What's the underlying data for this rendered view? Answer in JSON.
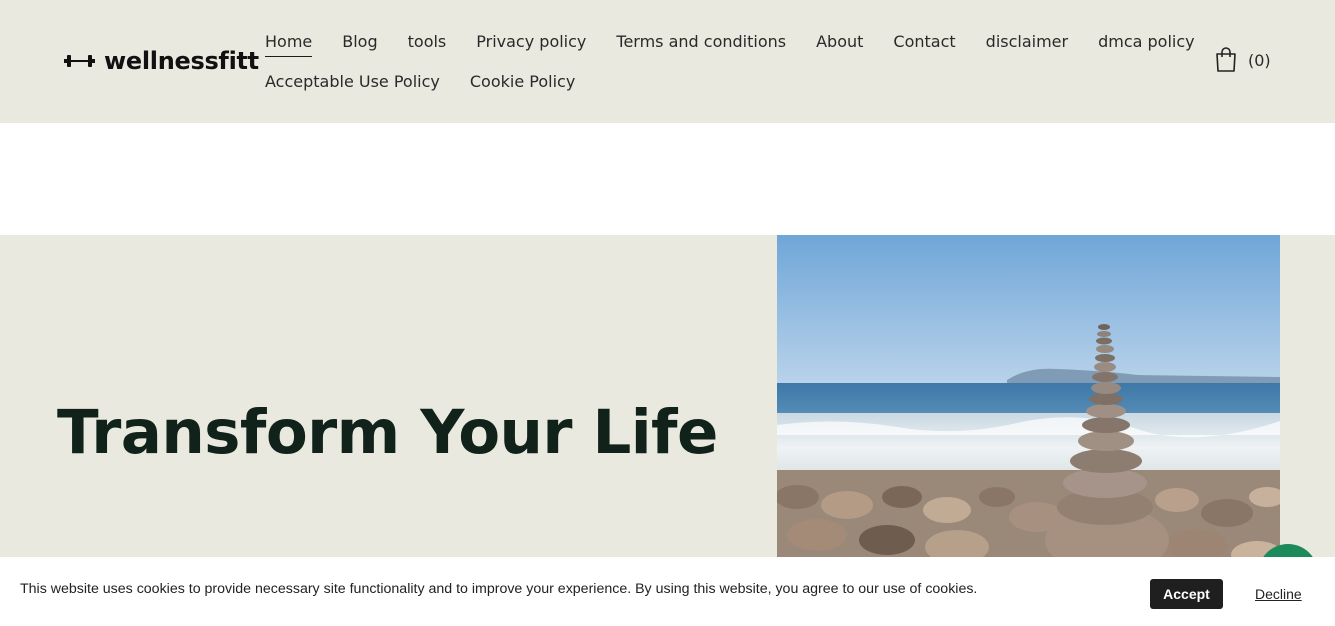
{
  "header": {
    "logo_text": "wellnessfitt",
    "logo_icon": "dumbbell-icon",
    "nav_row1": [
      "Home",
      "Blog",
      "tools",
      "Privacy policy",
      "Terms and conditions",
      "About",
      "Contact",
      "disclaimer",
      "dmca policy"
    ],
    "nav_row2": [
      "Acceptable Use Policy",
      "Cookie Policy"
    ],
    "active_nav": "Home",
    "cart_icon": "shopping-bag-icon",
    "cart_count": "(0)"
  },
  "hero": {
    "title": "Transform Your Life",
    "image_alt": "stacked stones cairn on a pebble beach by the sea"
  },
  "chat": {
    "icon": "chat-icon"
  },
  "cookie_banner": {
    "message": "This website uses cookies to provide necessary site functionality and to improve your experience. By using this website, you agree to our use of cookies.",
    "accept_label": "Accept",
    "decline_label": "Decline"
  },
  "colors": {
    "header_bg": "#e9e9df",
    "hero_bg": "#e9e9df",
    "title_color": "#10221a",
    "accept_bg": "#1f1f1f",
    "chat_bg": "#1d8a5c"
  }
}
